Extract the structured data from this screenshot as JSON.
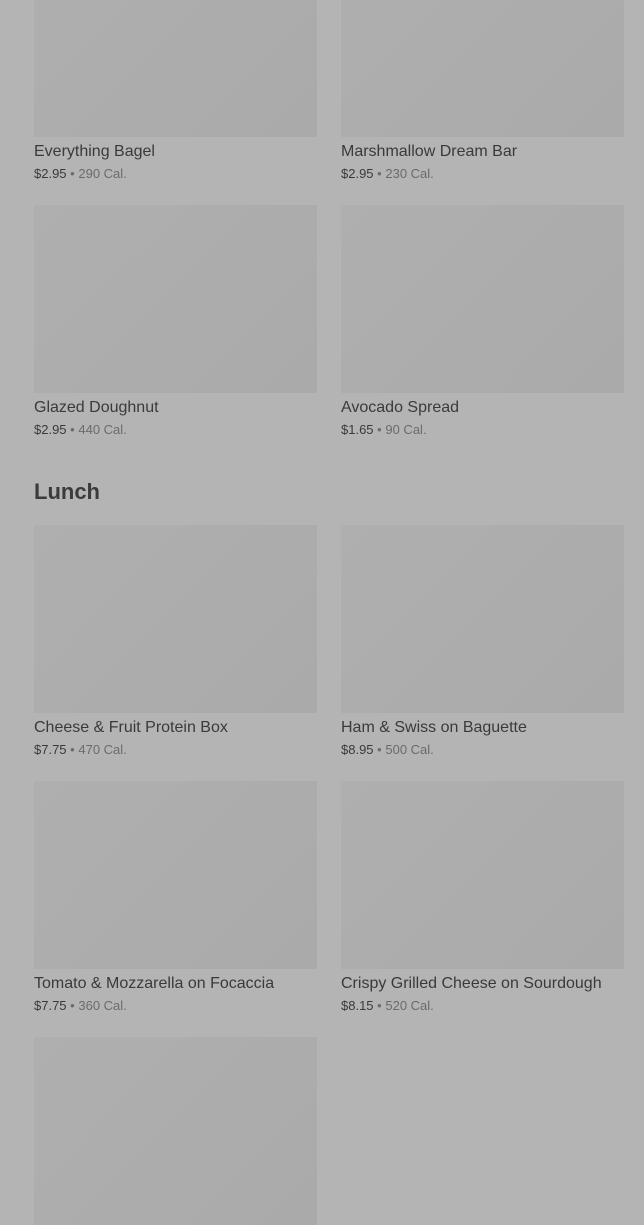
{
  "breakfast_items": [
    {
      "name": "Everything Bagel",
      "price": "$2.95",
      "separator": "•",
      "calories": "290 Cal."
    },
    {
      "name": "Marshmallow Dream Bar",
      "price": "$2.95",
      "separator": "•",
      "calories": "230 Cal."
    },
    {
      "name": "Glazed Doughnut",
      "price": "$2.95",
      "separator": "•",
      "calories": "440 Cal."
    },
    {
      "name": "Avocado Spread",
      "price": "$1.65",
      "separator": "•",
      "calories": "90 Cal."
    }
  ],
  "lunch": {
    "title": "Lunch",
    "items": [
      {
        "name": "Cheese & Fruit Protein Box",
        "price": "$7.75",
        "separator": "•",
        "calories": "470 Cal."
      },
      {
        "name": "Ham & Swiss on Baguette",
        "price": "$8.95",
        "separator": "•",
        "calories": "500 Cal."
      },
      {
        "name": "Tomato & Mozzarella on Focaccia",
        "price": "$7.75",
        "separator": "•",
        "calories": "360 Cal."
      },
      {
        "name": "Crispy Grilled Cheese on Sourdough",
        "price": "$8.15",
        "separator": "•",
        "calories": "520 Cal."
      }
    ]
  }
}
